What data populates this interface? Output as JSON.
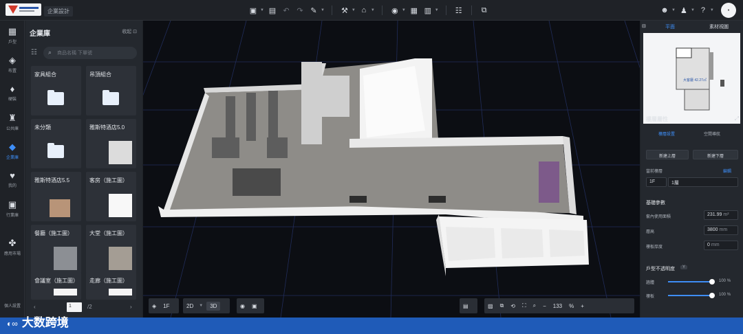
{
  "header": {
    "project_label": "企業設計"
  },
  "nav": [
    "戶型",
    "布置",
    "硬裝",
    "公共庫",
    "企業庫",
    "我的",
    "行業庫",
    "應用市場",
    "個人設置"
  ],
  "library": {
    "title": "企業庫",
    "collapse": "收起 ⊡",
    "search_placeholder": "商品名稱 下單號",
    "items": [
      "家具組合",
      "吊頂組合",
      "未分類",
      "雅斯特酒店5.0",
      "雅斯特酒店5.5",
      "客房（施工圖）",
      "餐廳（施工圖）",
      "大堂（施工圖）",
      "會議室（施工圖）",
      "走廊（施工圖）"
    ],
    "page": "1",
    "page_total": "/2"
  },
  "viewport": {
    "floor": "1F",
    "view2d": "2D",
    "view3d": "3D",
    "zoom": "133",
    "zoom_unit": "%"
  },
  "right": {
    "tabs": [
      "平面",
      "素材視圖"
    ],
    "minimap_label": "大客廳 42.27㎡",
    "floor_title": "樓層屬性",
    "floor_tabs": [
      "樓層設置",
      "空間導航"
    ],
    "btn_up": "新建上層",
    "btn_down": "新建下層",
    "current_floor_label": "當前樓層",
    "current_floor_edit": "編輯",
    "floor_code": "1F",
    "floor_name": "1層",
    "basic_title": "基礎參數",
    "area_label": "套內使用面積",
    "area_value": "231.99",
    "area_unit": "m²",
    "height_label": "層高",
    "height_value": "3800",
    "height_unit": "mm",
    "slab_label": "樓板厚度",
    "slab_value": "0",
    "slab_unit": "mm",
    "opacity_title": "戶型不透明度",
    "opacity_badge": "Y",
    "wall_label": "牆體",
    "wall_value": "100",
    "wall_pct": 1.0,
    "floor_label": "樓板",
    "floor_value": "100",
    "floor_pct": 1.0,
    "pct": "%"
  },
  "watermark": {
    "brand": "大数跨境"
  }
}
